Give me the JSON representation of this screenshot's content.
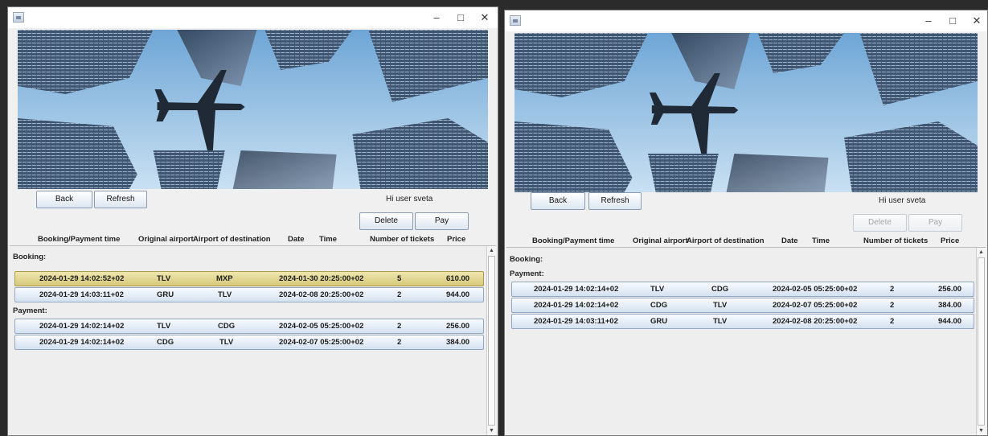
{
  "colors": {
    "sky": "#8db9dd",
    "selected_row": "#e4d894",
    "row": "#dfe8f3"
  },
  "left_window": {
    "controls": {
      "minimize": "–",
      "maximize": "□",
      "close": "✕"
    },
    "toolbar": {
      "back": "Back",
      "refresh": "Refresh",
      "greeting": "Hi user sveta",
      "delete": "Delete",
      "pay": "Pay"
    },
    "columns": [
      "Booking/Payment time",
      "Original airport",
      "Airport of destination",
      "Date",
      "Time",
      "Number of tickets",
      "Price"
    ],
    "booking_label": "Booking:",
    "booking_rows": [
      {
        "time": "2024-01-29 14:02:52+02",
        "origin": "TLV",
        "destination": "MXP",
        "datetime": "2024-01-30 20:25:00+02",
        "tickets": "5",
        "price": "610.00"
      },
      {
        "time": "2024-01-29 14:03:11+02",
        "origin": "GRU",
        "destination": "TLV",
        "datetime": "2024-02-08 20:25:00+02",
        "tickets": "2",
        "price": "944.00"
      }
    ],
    "payment_label": "Payment:",
    "payment_rows": [
      {
        "time": "2024-01-29 14:02:14+02",
        "origin": "TLV",
        "destination": "CDG",
        "datetime": "2024-02-05 05:25:00+02",
        "tickets": "2",
        "price": "256.00"
      },
      {
        "time": "2024-01-29 14:02:14+02",
        "origin": "CDG",
        "destination": "TLV",
        "datetime": "2024-02-07 05:25:00+02",
        "tickets": "2",
        "price": "384.00"
      }
    ]
  },
  "right_window": {
    "controls": {
      "minimize": "–",
      "maximize": "□",
      "close": "✕"
    },
    "toolbar": {
      "back": "Back",
      "refresh": "Refresh",
      "greeting": "Hi user sveta",
      "delete": "Delete",
      "pay": "Pay"
    },
    "columns": [
      "Booking/Payment time",
      "Original airport",
      "Airport of destination",
      "Date",
      "Time",
      "Number of tickets",
      "Price"
    ],
    "booking_label": "Booking:",
    "payment_label": "Payment:",
    "payment_rows": [
      {
        "time": "2024-01-29 14:02:14+02",
        "origin": "TLV",
        "destination": "CDG",
        "datetime": "2024-02-05 05:25:00+02",
        "tickets": "2",
        "price": "256.00"
      },
      {
        "time": "2024-01-29 14:02:14+02",
        "origin": "CDG",
        "destination": "TLV",
        "datetime": "2024-02-07 05:25:00+02",
        "tickets": "2",
        "price": "384.00"
      },
      {
        "time": "2024-01-29 14:03:11+02",
        "origin": "GRU",
        "destination": "TLV",
        "datetime": "2024-02-08 20:25:00+02",
        "tickets": "2",
        "price": "944.00"
      }
    ]
  }
}
